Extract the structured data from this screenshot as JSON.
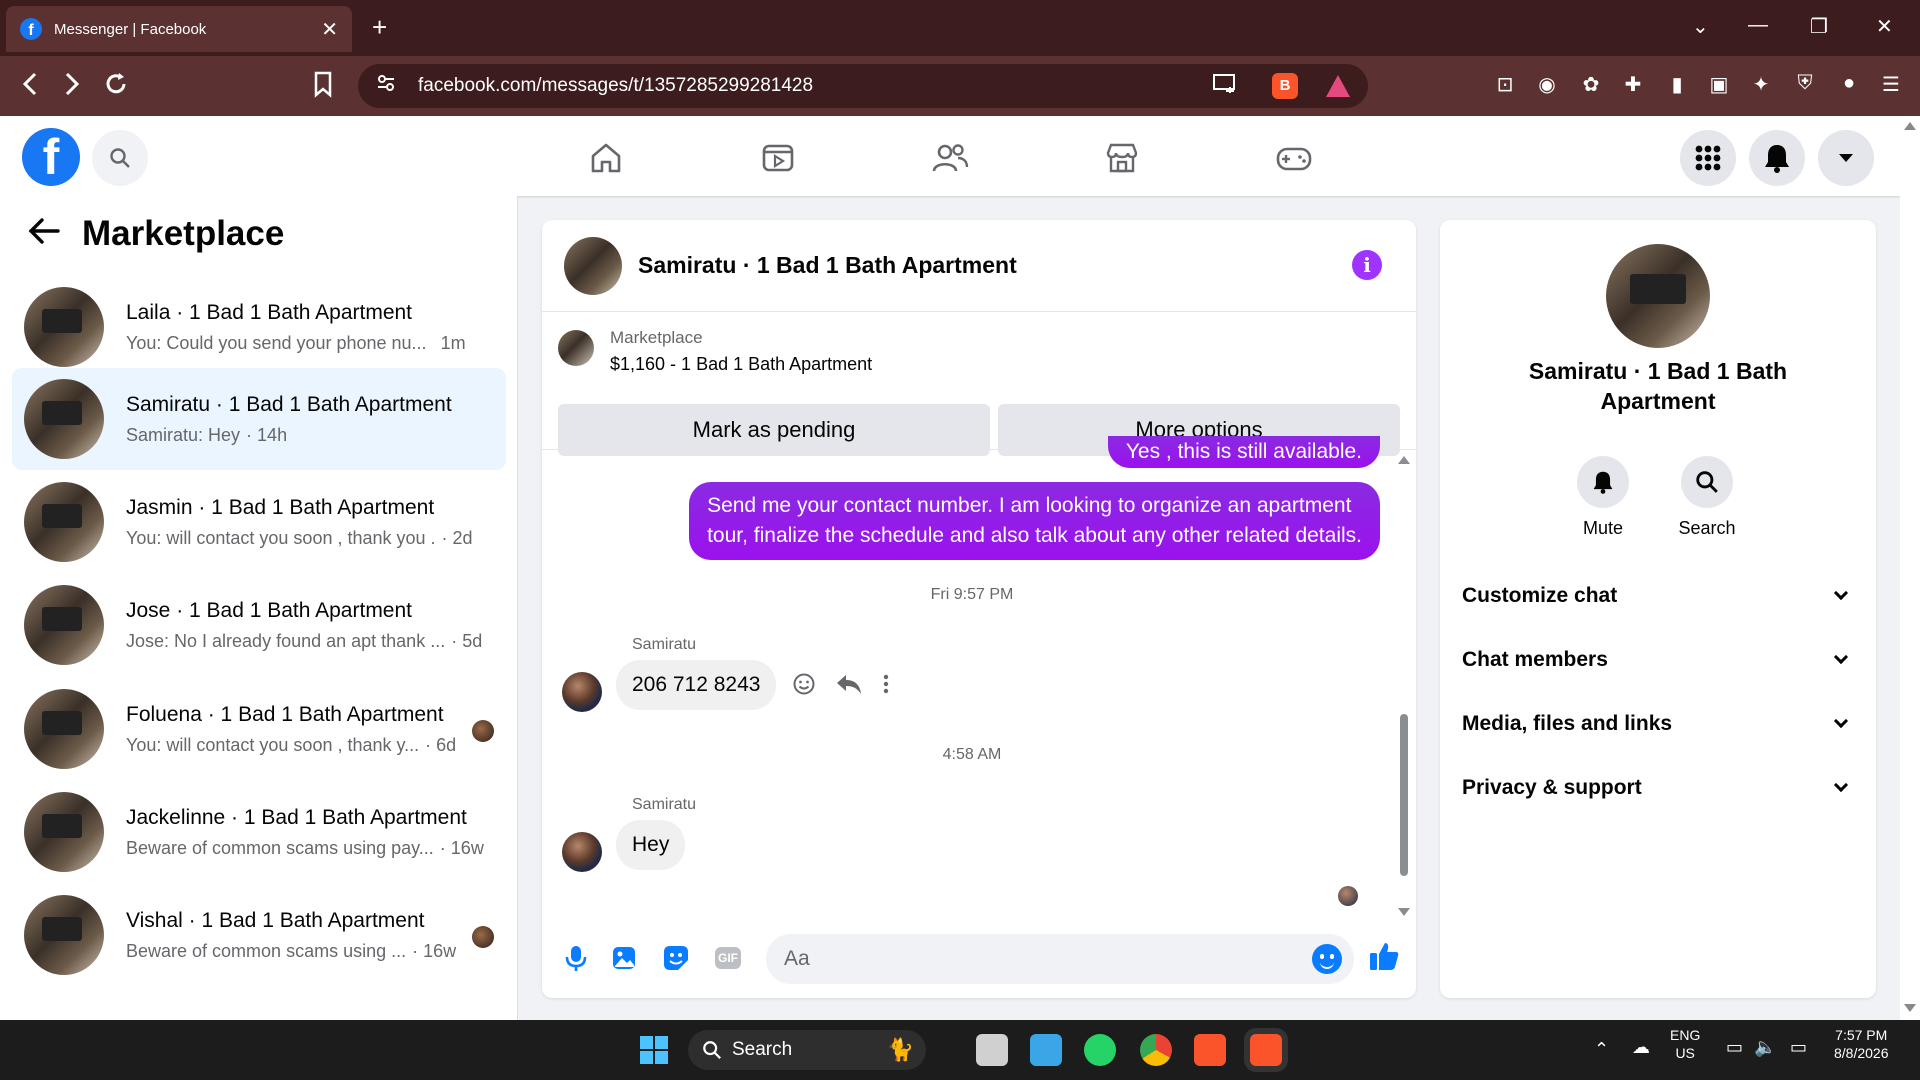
{
  "browser": {
    "tab_title": "Messenger | Facebook",
    "tab_close": "✕",
    "new_tab": "+",
    "url": "facebook.com/messages/t/1357285299281428"
  },
  "sidebar": {
    "title": "Marketplace",
    "conversations": [
      {
        "name": "Laila · 1 Bad 1 Bath Apartment",
        "preview": "You: Could you send your phone nu...",
        "time": "1m",
        "active": false
      },
      {
        "name": "Samiratu · 1 Bad 1 Bath Apartment",
        "preview": "Samiratu: Hey",
        "time": "· 14h",
        "active": true
      },
      {
        "name": "Jasmin · 1 Bad 1 Bath Apartment",
        "preview": "You: will contact you soon , thank you .",
        "time": "· 2d",
        "active": false
      },
      {
        "name": "Jose · 1 Bad 1 Bath Apartment",
        "preview": "Jose: No I already found an apt thank ...",
        "time": "· 5d",
        "active": false
      },
      {
        "name": "Foluena · 1 Bad 1 Bath Apartment",
        "preview": "You: will contact you soon , thank y...",
        "time": "· 6d",
        "active": false
      },
      {
        "name": "Jackelinne · 1 Bad 1 Bath Apartment",
        "preview": "Beware of common scams using pay...",
        "time": "· 16w",
        "active": false
      },
      {
        "name": "Vishal · 1 Bad 1 Bath Apartment",
        "preview": "Beware of common scams using ...",
        "time": "· 16w",
        "active": false
      }
    ]
  },
  "chat": {
    "title": "Samiratu · 1 Bad 1 Bath Apartment",
    "marketplace_label": "Marketplace",
    "listing": "$1,160 - 1 Bad 1 Bath Apartment",
    "mark_pending": "Mark as pending",
    "more_options": "More options",
    "msg_partial": "Yes , this is still available.",
    "msg_out_1": "Send me your contact number. I am looking to organize an apartment",
    "msg_out_2": "tour, finalize the schedule and also talk about any other related details.",
    "ts_1": "Fri 9:57 PM",
    "sender_1": "Samiratu",
    "msg_in_1": "206 712 8243",
    "ts_2": "4:58 AM",
    "sender_2": "Samiratu",
    "msg_in_2": "Hey",
    "input_placeholder": "Aa"
  },
  "right_panel": {
    "name": "Samiratu · 1 Bad 1 Bath Apartment",
    "mute_label": "Mute",
    "search_label": "Search",
    "items": [
      "Customize chat",
      "Chat members",
      "Media, files and links",
      "Privacy & support"
    ]
  },
  "taskbar": {
    "search_label": "Search",
    "lang_1": "ENG",
    "lang_2": "US",
    "time": "7:57 PM",
    "date": "8/8/2026"
  },
  "colors": {
    "facebook_blue": "#1877f2",
    "messenger_purple": "#9b11ee",
    "active_conv": "#ebf5ff"
  }
}
